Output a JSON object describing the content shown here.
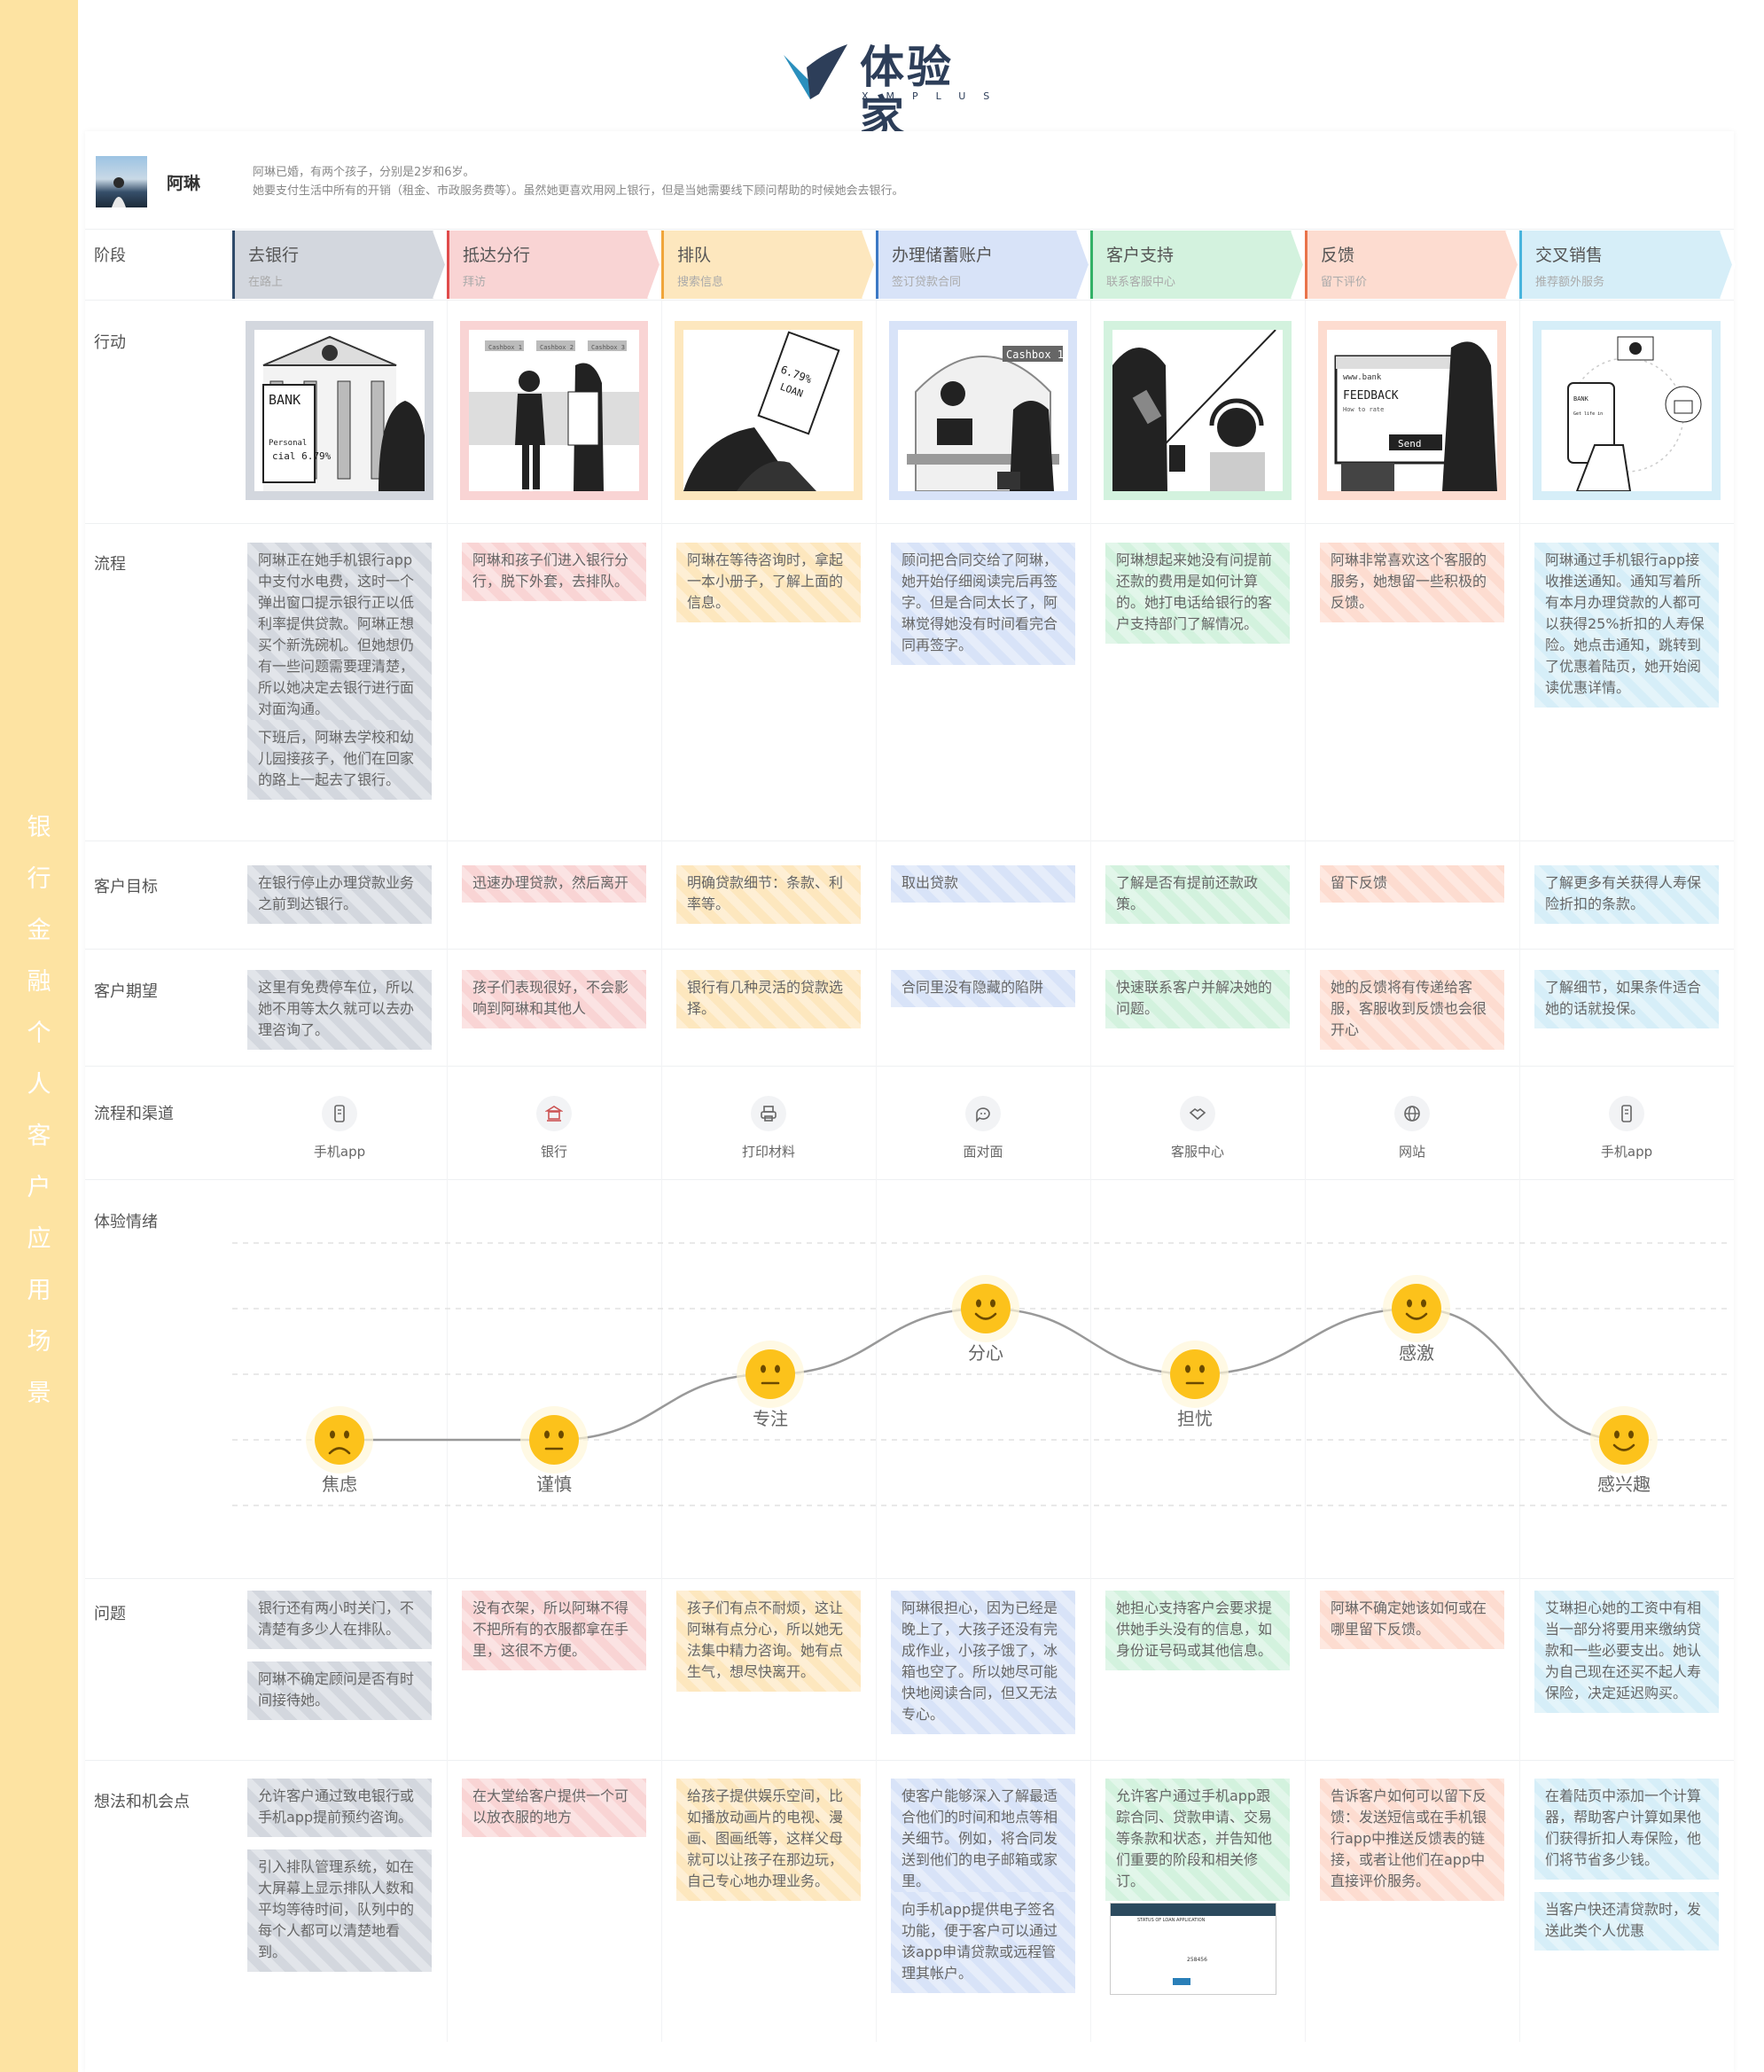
{
  "sidebar_title": "银行金融个人客户应用场景",
  "logo": {
    "cn": "体验家",
    "en": "XMPLUS"
  },
  "persona": {
    "name": "阿琳",
    "desc1": "阿琳已婚，有两个孩子，分别是2岁和6岁。",
    "desc2": "她要支付生活中所有的开销（租金、市政服务费等）。虽然她更喜欢用网上银行，但是当她需要线下顾问帮助的时候她会去银行。"
  },
  "row_labels": [
    "阶段",
    "行动",
    "流程",
    "客户目标",
    "客户期望",
    "流程和渠道",
    "体验情绪",
    "问题",
    "想法和机会点"
  ],
  "colors": {
    "s0": "#d3d7de",
    "s1": "#f9d4d4",
    "s2": "#fde7be",
    "s3": "#d8e3f8",
    "s4": "#d3f2de",
    "s5": "#fddcd0",
    "s6": "#d6eef8",
    "b0": "#2f4a6a",
    "b1": "#e04b4b",
    "b2": "#f0a53a",
    "b3": "#3b78c4",
    "b4": "#33b167",
    "b5": "#e9734a",
    "b6": "#48b4dd",
    "emoji": "#fcc21b"
  },
  "illustrations": {
    "bank_sign": "BANK",
    "loan_sign": "Personal loan special 6.79%",
    "counters": [
      "Cashbox 1",
      "Cashbox 2",
      "Cashbox 3"
    ],
    "brochure": "6.79% LOAN",
    "cashbox": "Cashbox 1",
    "screen_url": "www.bank",
    "feedback": "FEEDBACK",
    "how_to": "How to rate",
    "send": "Send",
    "push": "BANK Message Get life insurance with 25% discount"
  },
  "stages": [
    {
      "title": "去银行",
      "sub": "在路上"
    },
    {
      "title": "抵达分行",
      "sub": "拜访"
    },
    {
      "title": "排队",
      "sub": "搜索信息"
    },
    {
      "title": "办理储蓄账户",
      "sub": "签订贷款合同"
    },
    {
      "title": "客户支持",
      "sub": "联系客服中心"
    },
    {
      "title": "反馈",
      "sub": "留下评价"
    },
    {
      "title": "交叉销售",
      "sub": "推荐额外服务"
    }
  ],
  "process": [
    [
      "阿琳正在她手机银行app中支付水电费，这时一个弹出窗口提示银行正以低利率提供贷款。阿琳正想买个新洗碗机。但她想仍有一些问题需要理清楚，所以她决定去银行进行面对面沟通。",
      "下班后，阿琳去学校和幼儿园接孩子，他们在回家的路上一起去了银行。"
    ],
    [
      "阿琳和孩子们进入银行分行，脱下外套，去排队。"
    ],
    [
      "阿琳在等待咨询时，拿起一本小册子，了解上面的信息。"
    ],
    [
      "顾问把合同交给了阿琳，她开始仔细阅读完后再签字。但是合同太长了，阿琳觉得她没有时间看完合同再签字。"
    ],
    [
      "阿琳想起来她没有问提前还款的费用是如何计算的。她打电话给银行的客户支持部门了解情况。"
    ],
    [
      "阿琳非常喜欢这个客服的服务，她想留一些积极的反馈。"
    ],
    [
      "阿琳通过手机银行app接收推送通知。通知写着所有本月办理贷款的人都可以获得25%折扣的人寿保险。她点击通知，跳转到了优惠着陆页，她开始阅读优惠详情。"
    ]
  ],
  "goals": [
    "在银行停止办理贷款业务之前到达银行。",
    "迅速办理贷款，然后离开",
    "明确贷款细节：条款、利率等。",
    "取出贷款",
    "了解是否有提前还款政策。",
    "留下反馈",
    "了解更多有关获得人寿保险折扣的条款。"
  ],
  "expectations": [
    "这里有免费停车位，所以她不用等太久就可以去办理咨询了。",
    "孩子们表现很好，不会影响到阿琳和其他人",
    "银行有几种灵活的贷款选择。",
    "合同里没有隐藏的陷阱",
    "快速联系客户并解决她的问题。",
    "她的反馈将有传递给客服，客服收到反馈也会很开心",
    "了解细节，如果条件适合她的话就投保。"
  ],
  "channels": [
    {
      "icon": "mobile-icon",
      "label": "手机app"
    },
    {
      "icon": "bank-icon",
      "label": "银行"
    },
    {
      "icon": "printer-icon",
      "label": "打印材料"
    },
    {
      "icon": "chat-icon",
      "label": "面对面"
    },
    {
      "icon": "handshake-icon",
      "label": "客服中心"
    },
    {
      "icon": "globe-icon",
      "label": "网站"
    },
    {
      "icon": "mobile-icon",
      "label": "手机app"
    }
  ],
  "emotions": [
    {
      "label": "焦虑",
      "level": 1,
      "mood": "sad"
    },
    {
      "label": "谨慎",
      "level": 1,
      "mood": "neutral"
    },
    {
      "label": "专注",
      "level": 2,
      "mood": "neutral"
    },
    {
      "label": "分心",
      "level": 3,
      "mood": "happy"
    },
    {
      "label": "担忧",
      "level": 2,
      "mood": "neutral"
    },
    {
      "label": "感激",
      "level": 3,
      "mood": "happy"
    },
    {
      "label": "感兴趣",
      "level": 1,
      "mood": "happy"
    }
  ],
  "problems": [
    [
      "银行还有两小时关门，不清楚有多少人在排队。",
      "阿琳不确定顾问是否有时间接待她。"
    ],
    [
      "没有衣架，所以阿琳不得不把所有的衣服都拿在手里，这很不方便。"
    ],
    [
      "孩子们有点不耐烦，这让阿琳有点分心，所以她无法集中精力咨询。她有点生气，想尽快离开。"
    ],
    [
      "阿琳很担心，因为已经是晚上了，大孩子还没有完成作业，小孩子饿了，冰箱也空了。所以她尽可能快地阅读合同，但又无法专心。"
    ],
    [
      "她担心支持客户会要求提供她手头没有的信息，如身份证号码或其他信息。"
    ],
    [
      "阿琳不确定她该如何或在哪里留下反馈。"
    ],
    [
      "艾琳担心她的工资中有相当一部分将要用来缴纳贷款和一些必要支出。她认为自己现在还买不起人寿保险，决定延迟购买。"
    ]
  ],
  "ideas": [
    [
      "允许客户通过致电银行或手机app提前预约咨询。",
      "引入排队管理系统，如在大屏幕上显示排队人数和平均等待时间，队列中的每个人都可以清楚地看到。"
    ],
    [
      "在大堂给客户提供一个可以放衣服的地方"
    ],
    [
      "给孩子提供娱乐空间，比如播放动画片的电视、漫画、图画纸等，这样父母就可以让孩子在那边玩，自己专心地办理业务。"
    ],
    [
      "使客户能够深入了解最适合他们的时间和地点等相关细节。例如，将合同发送到他们的电子邮箱或家里。",
      "向手机app提供电子签名功能，便于客户可以通过该app申请贷款或远程管理其帐户。"
    ],
    [
      "允许客户通过手机app跟踪合同、贷款申请、交易等条款和状态，并告知他们重要的阶段和相关修订。"
    ],
    [
      "告诉客户如何可以留下反馈：发送短信或在手机银行app中推送反馈表的链接，或者让他们在app中直接评价服务。"
    ],
    [
      "在着陆页中添加一个计算器，帮助客户计算如果他们获得折扣人寿保险，他们将节省多少钱。",
      "当客户快还清贷款时，发送此类个人优惠"
    ]
  ],
  "loan_form": {
    "title": "STATUS OF LOAN APPLICATION",
    "field": "258456"
  }
}
